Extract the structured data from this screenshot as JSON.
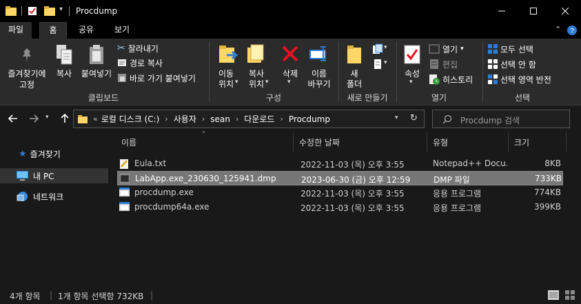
{
  "window": {
    "title": "Procdump"
  },
  "tabs": [
    "파일",
    "홈",
    "공유",
    "보기"
  ],
  "ribbon": {
    "clipboard": {
      "pin_label_1": "즐겨찾기에",
      "pin_label_2": "고정",
      "copy": "복사",
      "paste": "붙여넣기",
      "cut": "잘라내기",
      "copy_path": "경로 복사",
      "paste_shortcut": "바로 가기 붙여넣기",
      "group": "클립보드"
    },
    "organize": {
      "move_1": "이동",
      "move_2": "위치",
      "copyto_1": "복사",
      "copyto_2": "위치",
      "delete": "삭제",
      "rename_1": "이름",
      "rename_2": "바꾸기",
      "group": "구성"
    },
    "new": {
      "new_folder_1": "새",
      "new_folder_2": "폴더",
      "group": "새로 만들기"
    },
    "open": {
      "properties": "속성",
      "open": "열기",
      "edit": "편집",
      "history": "히스토리",
      "group": "열기"
    },
    "select": {
      "select_all": "모두 선택",
      "select_none": "선택 안 함",
      "invert": "선택 영역 반전",
      "group": "선택"
    }
  },
  "address": {
    "crumbs": [
      "로컬 디스크 (C:)",
      "사용자",
      "sean",
      "다운로드",
      "Procdump"
    ],
    "overflow": "«"
  },
  "search": {
    "placeholder": "Procdump 검색"
  },
  "nav": {
    "quick_access": "즐겨찾기",
    "this_pc": "내 PC",
    "network": "네트워크"
  },
  "columns": {
    "name": "이름",
    "modified": "수정한 날짜",
    "type": "유형",
    "size": "크기"
  },
  "files": [
    {
      "name": "Eula.txt",
      "modified": "2022-11-03 (목) 오후 3:55",
      "type": "Notepad++ Docu...",
      "size": "8KB"
    },
    {
      "name": "LabApp.exe_230630_125941.dmp",
      "modified": "2023-06-30 (금) 오후 12:59",
      "type": "DMP 파일",
      "size": "733KB"
    },
    {
      "name": "procdump.exe",
      "modified": "2022-11-03 (목) 오후 3:55",
      "type": "응용 프로그램",
      "size": "774KB"
    },
    {
      "name": "procdump64a.exe",
      "modified": "2022-11-03 (목) 오후 3:55",
      "type": "응용 프로그램",
      "size": "399KB"
    }
  ],
  "status": {
    "count": "4개 항목",
    "selected": "1개 항목 선택함 732KB"
  },
  "colors": {
    "accent": "#0078d7",
    "folder": "#ffd766",
    "delete": "#e81123",
    "selection": "#777777"
  }
}
